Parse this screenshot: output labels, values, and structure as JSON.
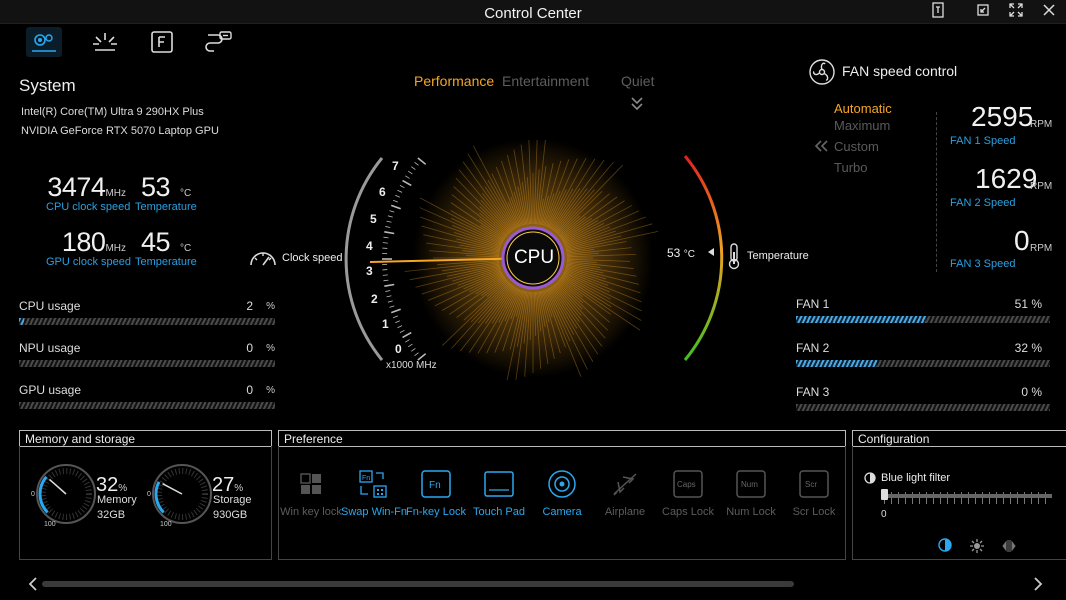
{
  "window": {
    "title": "Control Center"
  },
  "tabs": [
    {
      "name": "system-tab",
      "icon": "system-settings-icon",
      "active": true
    },
    {
      "name": "lighting-tab",
      "icon": "lighting-icon",
      "active": false
    },
    {
      "name": "function-key-tab",
      "icon": "function-key-icon",
      "active": false
    },
    {
      "name": "usb-tab",
      "icon": "usb-icon",
      "active": false
    }
  ],
  "system": {
    "title": "System",
    "cpu_name": "Intel(R) Core(TM) Ultra 9 290HX Plus",
    "gpu_name": "NVIDIA GeForce RTX 5070 Laptop GPU",
    "cpu_clock": "3474",
    "cpu_clock_unit": "MHz",
    "cpu_clock_label": "CPU clock speed",
    "cpu_temp": "53",
    "cpu_temp_unit": "°C",
    "cpu_temp_label": "Temperature",
    "gpu_clock": "180",
    "gpu_clock_unit": "MHz",
    "gpu_clock_label": "GPU clock speed",
    "gpu_temp": "45",
    "gpu_temp_unit": "°C",
    "gpu_temp_label": "Temperature"
  },
  "usage": [
    {
      "label": "CPU usage",
      "value": "2",
      "unit": "%",
      "fraction": 0.02
    },
    {
      "label": "NPU usage",
      "value": "0",
      "unit": "%",
      "fraction": 0
    },
    {
      "label": "GPU usage",
      "value": "0",
      "unit": "%",
      "fraction": 0
    }
  ],
  "modes": {
    "performance": "Performance",
    "entertainment": "Entertainment",
    "quiet": "Quiet",
    "active": "Performance"
  },
  "gauge": {
    "center": "CPU",
    "clock_label": "Clock speed",
    "temp_label": "Temperature",
    "temp_value": "53",
    "temp_unit": "°C",
    "unit_label": "x1000 MHz",
    "ticks": [
      "0",
      "1",
      "2",
      "3",
      "4",
      "5",
      "6",
      "7"
    ],
    "clock_ghz": 3.47,
    "accent": "#f5a623"
  },
  "fan": {
    "title": "FAN speed control",
    "modes": [
      "Automatic",
      "Maximum",
      "Custom",
      "Turbo"
    ],
    "active_mode": "Automatic",
    "speeds": [
      {
        "value": "2595",
        "unit": "RPM",
        "label": "FAN 1 Speed"
      },
      {
        "value": "1629",
        "unit": "RPM",
        "label": "FAN 2 Speed"
      },
      {
        "value": "0",
        "unit": "RPM",
        "label": "FAN 3 Speed"
      }
    ],
    "bars": [
      {
        "label": "FAN 1",
        "value": "51 %",
        "fraction": 0.51
      },
      {
        "label": "FAN 2",
        "value": "32 %",
        "fraction": 0.32
      },
      {
        "label": "FAN 3",
        "value": "0 %",
        "fraction": 0
      }
    ]
  },
  "memory": {
    "title": "Memory and storage",
    "mem_percent": "32",
    "mem_label": "Memory",
    "mem_size": "32GB",
    "mem_fraction": 0.32,
    "sto_percent": "27",
    "sto_label": "Storage",
    "sto_size": "930GB",
    "sto_fraction": 0.27,
    "pct": "%",
    "min": "0",
    "max": "100"
  },
  "preference": {
    "title": "Preference",
    "items": [
      {
        "label": "Win key lock",
        "icon": "windows-key-icon",
        "on": false
      },
      {
        "label": "Swap Win-Fn",
        "icon": "swap-win-fn-icon",
        "on": true
      },
      {
        "label": "Fn-key Lock",
        "icon": "fn-key-lock-icon",
        "on": true
      },
      {
        "label": "Touch Pad",
        "icon": "touchpad-icon",
        "on": true
      },
      {
        "label": "Camera",
        "icon": "camera-icon",
        "on": true
      },
      {
        "label": "Airplane",
        "icon": "airplane-icon",
        "on": false
      },
      {
        "label": "Caps Lock",
        "icon": "caps-lock-icon",
        "on": false
      },
      {
        "label": "Num Lock",
        "icon": "num-lock-icon",
        "on": false
      },
      {
        "label": "Scr Lock",
        "icon": "scroll-lock-icon",
        "on": false
      }
    ],
    "key_caps": {
      "fn": "Fn",
      "caps": "Caps",
      "num": "Num",
      "scr": "Scr"
    }
  },
  "configuration": {
    "title": "Configuration",
    "blue_light_label": "Blue light filter",
    "blue_light_value": "0"
  }
}
